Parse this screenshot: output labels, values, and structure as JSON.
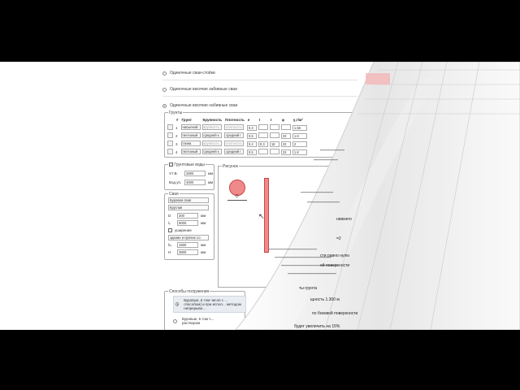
{
  "options": [
    {
      "label": "Одиночные сваи-стойки",
      "selected": false
    },
    {
      "label": "Одиночные висячие забивные сваи",
      "selected": false
    },
    {
      "label": "Одиночные висячие набивные сваи",
      "selected": true
    }
  ],
  "soils": {
    "legend": "Грунты",
    "headers": [
      "#",
      "Грунт",
      "Крупность",
      "Плотность",
      "e",
      "I",
      "I",
      "φ",
      "γ,т/м³",
      "S"
    ],
    "rows": [
      {
        "n": "1",
        "soil": "насыпной",
        "size": "крупность",
        "density": "плотность",
        "e": "0.3",
        "i1": "",
        "i2": "",
        "phi": "",
        "gamma": "1.56"
      },
      {
        "n": "2",
        "soil": "песчаный",
        "size": "средней к",
        "density": "средний г",
        "e": "0.5",
        "i1": "",
        "i2": "",
        "phi": "23",
        "gamma": "1.8"
      },
      {
        "n": "3",
        "soil": "глина",
        "size": "крупность",
        "density": "плотность",
        "e": "0.4",
        "i1": "0.3",
        "i2": "18",
        "phi": "22",
        "gamma": "2"
      },
      {
        "n": "4",
        "soil": "песчаный",
        "size": "средней к",
        "density": "средний г",
        "e": "0.5",
        "i1": "",
        "i2": "",
        "phi": "23",
        "gamma": "1.8"
      }
    ]
  },
  "water": {
    "legend": "Грунтовые воды",
    "checked": "✓",
    "ugv_label": "У.Г.В.",
    "ugv_value": "2800",
    "ugv_unit": "мм",
    "vod_label": "Вод.уп.",
    "vod_value": "4000",
    "vod_unit": "мм"
  },
  "pile": {
    "legend": "Свая",
    "type": "Буровая свая",
    "shape": "Круглая",
    "d_label": "D",
    "d_value": "300",
    "d_unit": "мм",
    "l_label": "lₚ",
    "l_value": "6000",
    "l_unit": "мм",
    "widen_label": "уширение",
    "widen_type": "здание и прочие со",
    "h1_label": "hₚ",
    "h1_value": "1500",
    "h1_unit": "мм",
    "h2_label": "H",
    "h2_value": "3800",
    "h2_unit": "мм"
  },
  "sketch": {
    "legend": "Рисунок",
    "label": "D"
  },
  "methods": {
    "legend": "Способы погружения",
    "items": [
      {
        "text": "Буровые, в том числе с ...",
        "sub": "способом) и при испол... методом непрерывн...",
        "selected": true
      },
      {
        "text": "Буровые, в том ч...",
        "sub": "раствором",
        "selected": false
      }
    ]
  },
  "rolled_text": [
    "нижнего",
    "=2",
    "сти равно нулю",
    "ой поверхности",
    "ты грунта",
    "щность 1.300 м",
    "по боковой поверхности",
    "будет увеличить на 15%"
  ]
}
